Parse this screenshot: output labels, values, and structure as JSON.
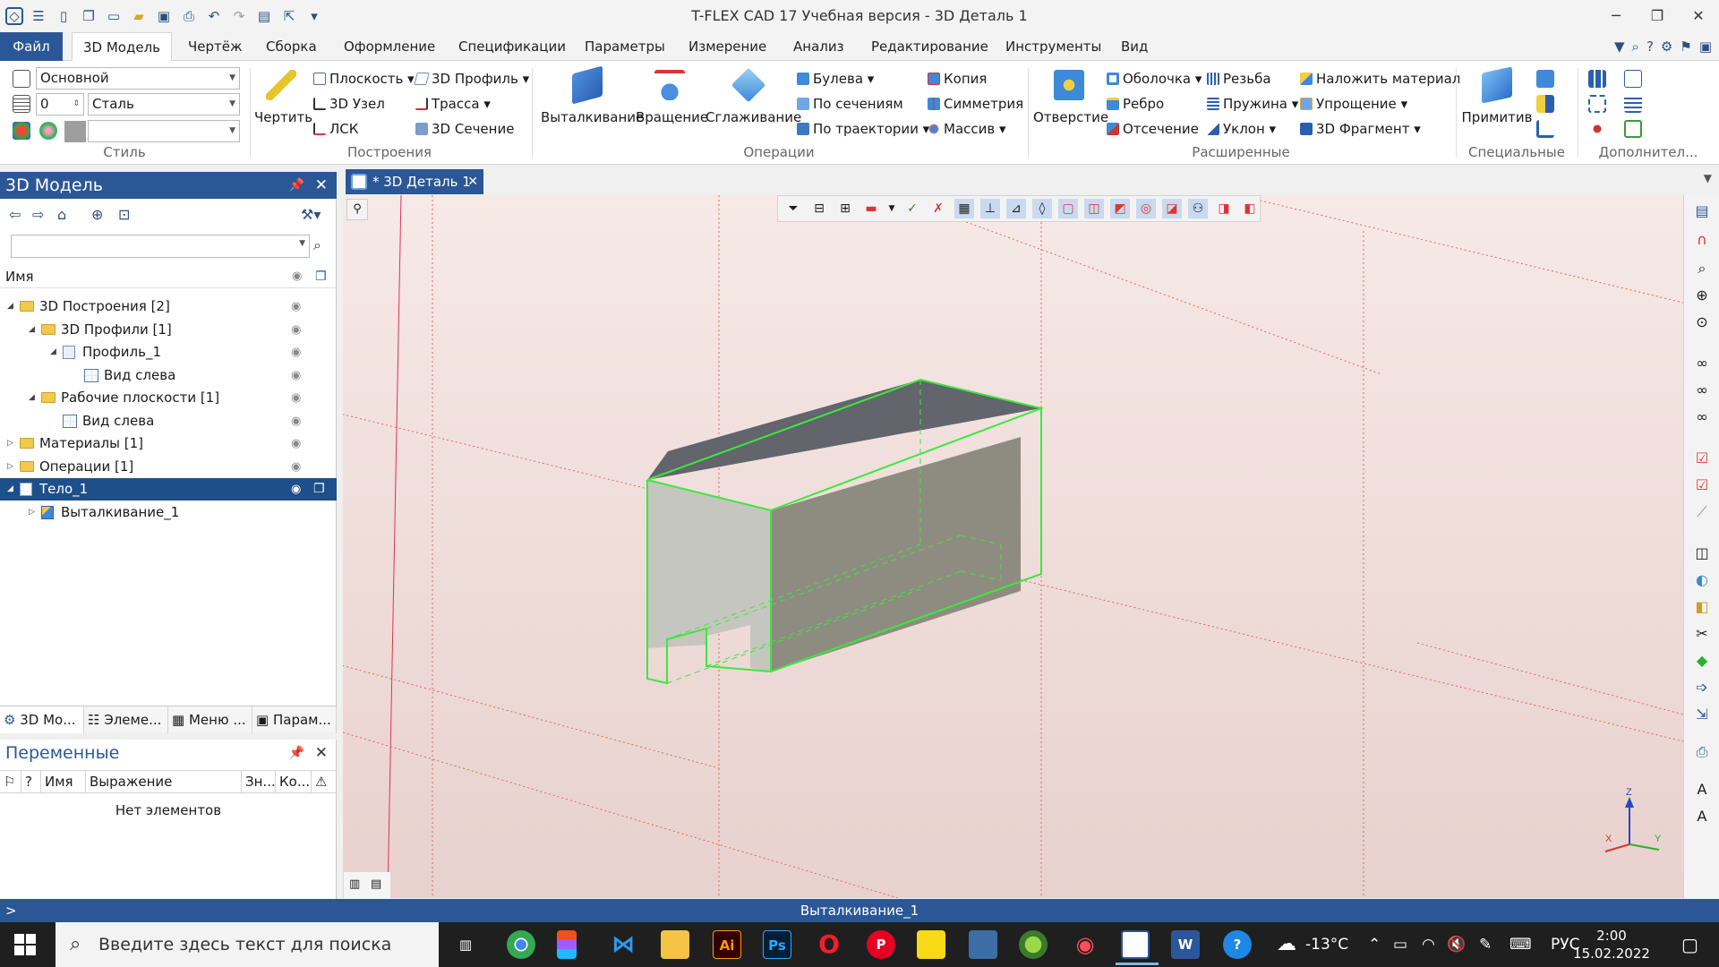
{
  "window": {
    "title": "T-FLEX CAD 17 Учебная версия - 3D Деталь 1",
    "min_icon": "minimize-icon",
    "max_icon": "restore-icon",
    "close_icon": "close-icon"
  },
  "ribbon_tabs": {
    "file": "Файл",
    "items": [
      "3D Модель",
      "Чертёж",
      "Сборка",
      "Оформление",
      "Спецификации",
      "Параметры",
      "Измерение",
      "Анализ",
      "Редактирование",
      "Инструменты",
      "Вид"
    ],
    "active": "3D Модель"
  },
  "style_group": {
    "layer_value": "Основной",
    "priority_value": "0",
    "material_value": "Сталь",
    "color_value": "",
    "label": "Стиль"
  },
  "build_group": {
    "draw": "Чертить",
    "plane": "Плоскость",
    "node": "3D Узел",
    "lsk": "ЛСК",
    "profile": "3D Профиль",
    "path": "Трасса",
    "section": "3D Сечение",
    "label": "Построения"
  },
  "ops_group": {
    "extrude": "Выталкивание",
    "rotate": "Вращение",
    "smooth": "Сглаживание",
    "bool": "Булева",
    "sections": "По сечениям",
    "traj": "По траектории",
    "copy": "Копия",
    "sym": "Симметрия",
    "array": "Массив",
    "label": "Операции"
  },
  "ext_group": {
    "hole": "Отверстие",
    "shell": "Оболочка",
    "rib": "Ребро",
    "cut": "Отсечение",
    "thread": "Резьба",
    "spring": "Пружина",
    "slope": "Уклон",
    "material": "Наложить материал",
    "simplify": "Упрощение",
    "fragment": "3D Фрагмент",
    "label": "Расширенные"
  },
  "special_group": {
    "prim": "Примитив",
    "label": "Специальные"
  },
  "extra_group": {
    "label": "Дополнител..."
  },
  "model_panel": {
    "title": "3D Модель",
    "column_name": "Имя",
    "tree": [
      {
        "label": "3D Построения [2]",
        "level": 0,
        "expanded": true,
        "icon": "folder-icon"
      },
      {
        "label": "3D Профили [1]",
        "level": 1,
        "expanded": true,
        "icon": "folder-icon"
      },
      {
        "label": "Профиль_1",
        "level": 2,
        "expanded": true,
        "icon": "profile-icon"
      },
      {
        "label": "Вид слева",
        "level": 3,
        "expanded": null,
        "icon": "plane-icon"
      },
      {
        "label": "Рабочие плоскости [1]",
        "level": 1,
        "expanded": true,
        "icon": "folder-icon"
      },
      {
        "label": "Вид слева",
        "level": 2,
        "expanded": null,
        "icon": "plane-icon"
      },
      {
        "label": "Материалы [1]",
        "level": 0,
        "expanded": false,
        "icon": "folder-icon"
      },
      {
        "label": "Операции [1]",
        "level": 0,
        "expanded": false,
        "icon": "folder-icon"
      },
      {
        "label": "Тело_1",
        "level": 0,
        "expanded": true,
        "icon": "body-icon",
        "selected": true
      },
      {
        "label": "Выталкивание_1",
        "level": 1,
        "expanded": false,
        "icon": "extrude-icon"
      }
    ],
    "bottom_tabs": [
      "3D Мо...",
      "Элеме...",
      "Меню ...",
      "Парам..."
    ]
  },
  "vars_panel": {
    "title": "Переменные",
    "columns": [
      "?",
      "Имя",
      "Выражение",
      "Зн...",
      "Ко..."
    ],
    "empty": "Нет элементов"
  },
  "document": {
    "tab": "* 3D Деталь 1"
  },
  "status": {
    "prompt": ">",
    "message": "Выталкивание_1"
  },
  "axes": {
    "x": "X",
    "y": "Y",
    "z": "Z"
  },
  "taskbar": {
    "search_placeholder": "Введите здесь текст для поиска",
    "weather": "-13°C",
    "lang": "РУС",
    "time": "2:00",
    "date": "15.02.2022"
  }
}
